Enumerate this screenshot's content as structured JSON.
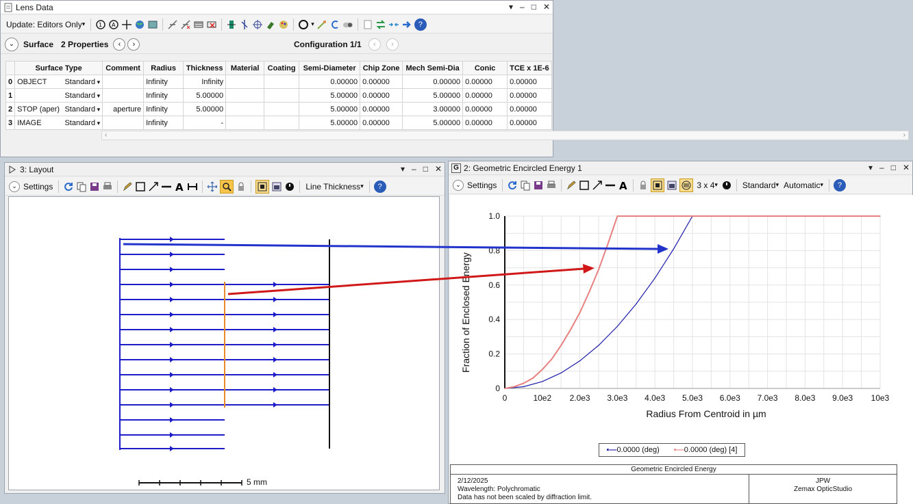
{
  "lens_data": {
    "title": "Lens Data",
    "update_label": "Update: Editors Only",
    "surface_label": "Surface",
    "properties_label": "2 Properties",
    "configuration_label": "Configuration 1/1",
    "columns": [
      "",
      "Surface Type",
      "Comment",
      "Radius",
      "Thickness",
      "Material",
      "Coating",
      "Semi-Diameter",
      "Chip Zone",
      "Mech Semi-Dia",
      "Conic",
      "TCE x 1E-6"
    ],
    "rows": [
      {
        "idx": "0",
        "name": "OBJECT",
        "type": "Standard",
        "comment": "",
        "radius": "Infinity",
        "thickness": "Infinity",
        "material": "",
        "coating": "",
        "semi": "0.00000",
        "chip": "0.00000",
        "mech": "0.00000",
        "conic": "0.00000",
        "tce": "0.00000"
      },
      {
        "idx": "1",
        "name": "",
        "type": "Standard",
        "comment": "",
        "radius": "Infinity",
        "thickness": "5.00000",
        "material": "",
        "coating": "",
        "semi": "5.00000",
        "chip": "0.00000",
        "mech": "5.00000",
        "conic": "0.00000",
        "tce": "0.00000"
      },
      {
        "idx": "2",
        "name": "STOP (aper)",
        "type": "Standard",
        "comment": "aperture",
        "radius": "Infinity",
        "thickness": "5.00000",
        "material": "",
        "coating": "",
        "semi": "5.00000",
        "chip": "0.00000",
        "mech": "3.00000",
        "conic": "0.00000",
        "tce": "0.00000"
      },
      {
        "idx": "3",
        "name": "IMAGE",
        "type": "Standard",
        "comment": "",
        "radius": "Infinity",
        "thickness": "-",
        "material": "",
        "coating": "",
        "semi": "5.00000",
        "chip": "0.00000",
        "mech": "5.00000",
        "conic": "0.00000",
        "tce": "0.00000"
      }
    ]
  },
  "layout": {
    "title": "3: Layout",
    "settings_label": "Settings",
    "line_thickness_label": "Line Thickness",
    "scale_label": "5 mm"
  },
  "energy": {
    "title": "2: Geometric Encircled Energy 1",
    "settings_label": "Settings",
    "grid_label": "3 x 4",
    "standard_label": "Standard",
    "automatic_label": "Automatic",
    "footer": {
      "title": "Geometric Encircled Energy",
      "date": "2/12/2025",
      "wavelength": "Wavelength: Polychromatic",
      "note": "Data has not been scaled by diffraction limit.",
      "author": "JPW",
      "product": "Zemax OpticStudio"
    }
  },
  "window_controls": {
    "dropdown": "▾",
    "minimize": "–",
    "maximize": "□",
    "close": "✕"
  },
  "colors": {
    "series1": "#1a1aa8",
    "series2": "#e88080",
    "ray": "#1c1cc8",
    "stop": "#e88a2a",
    "annotation_blue": "#2233cc",
    "annotation_red": "#d01818"
  },
  "chart_data": {
    "type": "line",
    "xlabel": "Radius From Centroid in µm",
    "ylabel": "Fraction of Enclosed Energy",
    "xlim": [
      0,
      10000
    ],
    "ylim": [
      0,
      1
    ],
    "x_ticks": [
      "0",
      "10e2",
      "2.0e3",
      "3.0e3",
      "4.0e3",
      "5.0e3",
      "6.0e3",
      "7.0e3",
      "8.0e3",
      "9.0e3",
      "10e3"
    ],
    "y_ticks": [
      "0",
      "0.2",
      "0.4",
      "0.6",
      "0.8",
      "1.0"
    ],
    "grid": true,
    "legend_position": "bottom-center",
    "series": [
      {
        "name": "0.0000 (deg)",
        "color": "#1a1aa8",
        "x": [
          0,
          500,
          1000,
          1500,
          2000,
          2500,
          3000,
          3500,
          4000,
          4500,
          5000,
          10000
        ],
        "y": [
          0,
          0.01,
          0.04,
          0.09,
          0.16,
          0.25,
          0.36,
          0.49,
          0.64,
          0.81,
          1.0,
          1.0
        ]
      },
      {
        "name": "0.0000 (deg) [4]",
        "color": "#e88080",
        "x": [
          0,
          250,
          500,
          750,
          1000,
          1250,
          1500,
          1750,
          2000,
          2250,
          2500,
          2750,
          3000,
          10000
        ],
        "y": [
          0,
          0.01,
          0.03,
          0.06,
          0.11,
          0.17,
          0.25,
          0.34,
          0.44,
          0.56,
          0.69,
          0.84,
          1.0,
          1.0
        ]
      }
    ]
  }
}
